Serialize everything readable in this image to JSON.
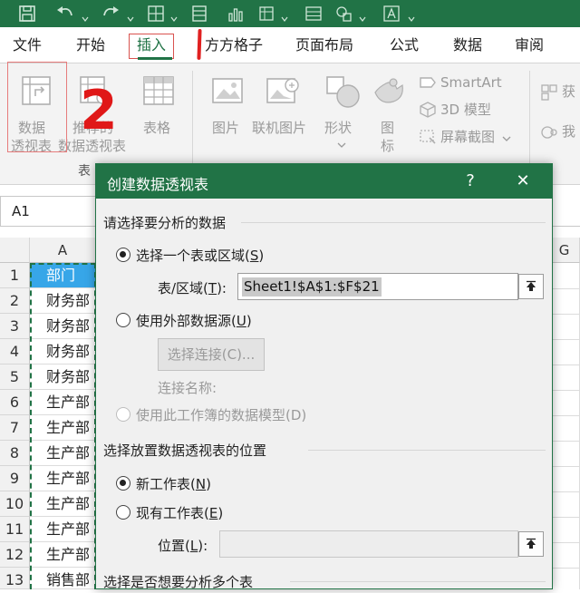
{
  "ribbon_tabs": [
    {
      "label": "文件"
    },
    {
      "label": "开始"
    },
    {
      "label": "插入"
    },
    {
      "label": "方方格子"
    },
    {
      "label": "页面布局"
    },
    {
      "label": "公式"
    },
    {
      "label": "数据"
    },
    {
      "label": "审阅"
    }
  ],
  "ribbon": {
    "pivot_table": {
      "line1": "数据",
      "line2": "透视表"
    },
    "recommended_pivot": {
      "line1": "推荐的",
      "line2": "数据透视表"
    },
    "table": {
      "label": "表格"
    },
    "group_tables_label": "表",
    "picture": {
      "label": "图片"
    },
    "online_picture": {
      "label": "联机图片"
    },
    "shapes": {
      "label": "形状"
    },
    "icons": {
      "line1": "图",
      "line2": "标"
    },
    "smartart": {
      "label": "SmartArt"
    },
    "model3d": {
      "label": "3D 模型"
    },
    "screenshot": {
      "label": "屏幕截图"
    },
    "right_partial_1": "获",
    "right_partial_2": "我"
  },
  "annotation_number": "2",
  "name_box": {
    "value": "A1"
  },
  "columns": [
    "A",
    "G"
  ],
  "rows": [
    {
      "num": "1",
      "a": "部门"
    },
    {
      "num": "2",
      "a": "财务部"
    },
    {
      "num": "3",
      "a": "财务部"
    },
    {
      "num": "4",
      "a": "财务部"
    },
    {
      "num": "5",
      "a": "财务部"
    },
    {
      "num": "6",
      "a": "生产部"
    },
    {
      "num": "7",
      "a": "生产部"
    },
    {
      "num": "8",
      "a": "生产部"
    },
    {
      "num": "9",
      "a": "生产部"
    },
    {
      "num": "10",
      "a": "生产部"
    },
    {
      "num": "11",
      "a": "生产部"
    },
    {
      "num": "12",
      "a": "生产部"
    },
    {
      "num": "13",
      "a": "销售部"
    }
  ],
  "dialog": {
    "title": "创建数据透视表",
    "help": "?",
    "close": "✕",
    "section_choose_data": "请选择要分析的数据",
    "option_select_range": {
      "text": "选择一个表或区域(",
      "key": "S",
      "end": ")"
    },
    "range_label": {
      "text": "表/区域(",
      "key": "T",
      "end": "):"
    },
    "range_value": "Sheet1!$A$1:$F$21",
    "option_external": {
      "text": "使用外部数据源(",
      "key": "U",
      "end": ")"
    },
    "choose_connection_button": "选择连接(C)...",
    "connection_name_label": "连接名称:",
    "option_data_model": "使用此工作簿的数据模型(D)",
    "section_location": "选择放置数据透视表的位置",
    "option_new_sheet": {
      "text": "新工作表(",
      "key": "N",
      "end": ")"
    },
    "option_existing_sheet": {
      "text": "现有工作表(",
      "key": "E",
      "end": ")"
    },
    "location_label": {
      "text": "位置(",
      "key": "L",
      "end": "):"
    },
    "location_value": "",
    "section_multiple": "选择是否想要分析多个表"
  }
}
